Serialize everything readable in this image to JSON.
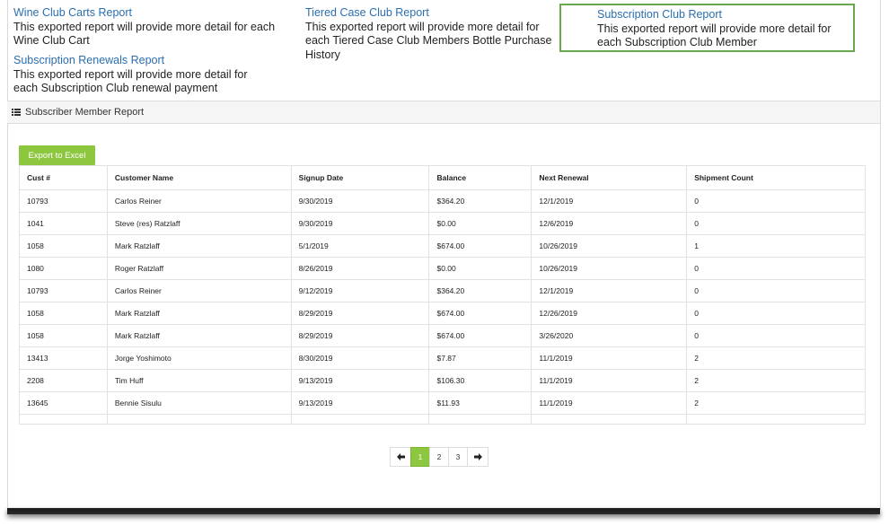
{
  "reports": [
    {
      "title": "Wine Club Carts Report",
      "desc": "This exported report will provide more detail for each Wine Club Cart"
    },
    {
      "title": "Tiered Case Club Report",
      "desc": "This exported report will provide more detail for each Tiered Case Club Members Bottle Purchase History"
    },
    {
      "title": "Subscription Club Report",
      "desc": "This exported report will provide more detail for each Subscription Club Member"
    },
    {
      "title": "Subscription Renewals Report",
      "desc": "This exported report will provide more detail for each Subscription Club renewal payment"
    }
  ],
  "panel": {
    "title": "Subscriber Member Report",
    "icon": "list-icon"
  },
  "export_label": "Export to Excel",
  "table": {
    "headers": [
      "Cust #",
      "Customer Name",
      "Signup Date",
      "Balance",
      "Next Renewal",
      "Shipment Count"
    ],
    "rows": [
      [
        "10793",
        "Carlos Reiner",
        "9/30/2019",
        "$364.20",
        "12/1/2019",
        "0"
      ],
      [
        "1041",
        "Steve (res) Ratzlaff",
        "9/30/2019",
        "$0.00",
        "12/6/2019",
        "0"
      ],
      [
        "1058",
        "Mark Ratzlaff",
        "5/1/2019",
        "$674.00",
        "10/26/2019",
        "1"
      ],
      [
        "1080",
        "Roger Ratzlaff",
        "8/26/2019",
        "$0.00",
        "10/26/2019",
        "0"
      ],
      [
        "10793",
        "Carlos Reiner",
        "9/12/2019",
        "$364.20",
        "12/1/2019",
        "0"
      ],
      [
        "1058",
        "Mark Ratzlaff",
        "8/29/2019",
        "$674.00",
        "12/26/2019",
        "0"
      ],
      [
        "1058",
        "Mark Ratzlaff",
        "8/29/2019",
        "$674.00",
        "3/26/2020",
        "0"
      ],
      [
        "13413",
        "Jorge Yoshimoto",
        "8/30/2019",
        "$7.87",
        "11/1/2019",
        "2"
      ],
      [
        "2208",
        "Tim Huff",
        "9/13/2019",
        "$106.30",
        "11/1/2019",
        "2"
      ],
      [
        "13645",
        "Bennie Sisulu",
        "9/13/2019",
        "$11.93",
        "11/1/2019",
        "2"
      ]
    ]
  },
  "pagination": {
    "prev": "←",
    "pages": [
      "1",
      "2",
      "3"
    ],
    "current": "1",
    "next": "→"
  },
  "colors": {
    "accent": "#8dc63f",
    "highlight_border": "#6aa84f",
    "link": "#2a6fb0"
  }
}
